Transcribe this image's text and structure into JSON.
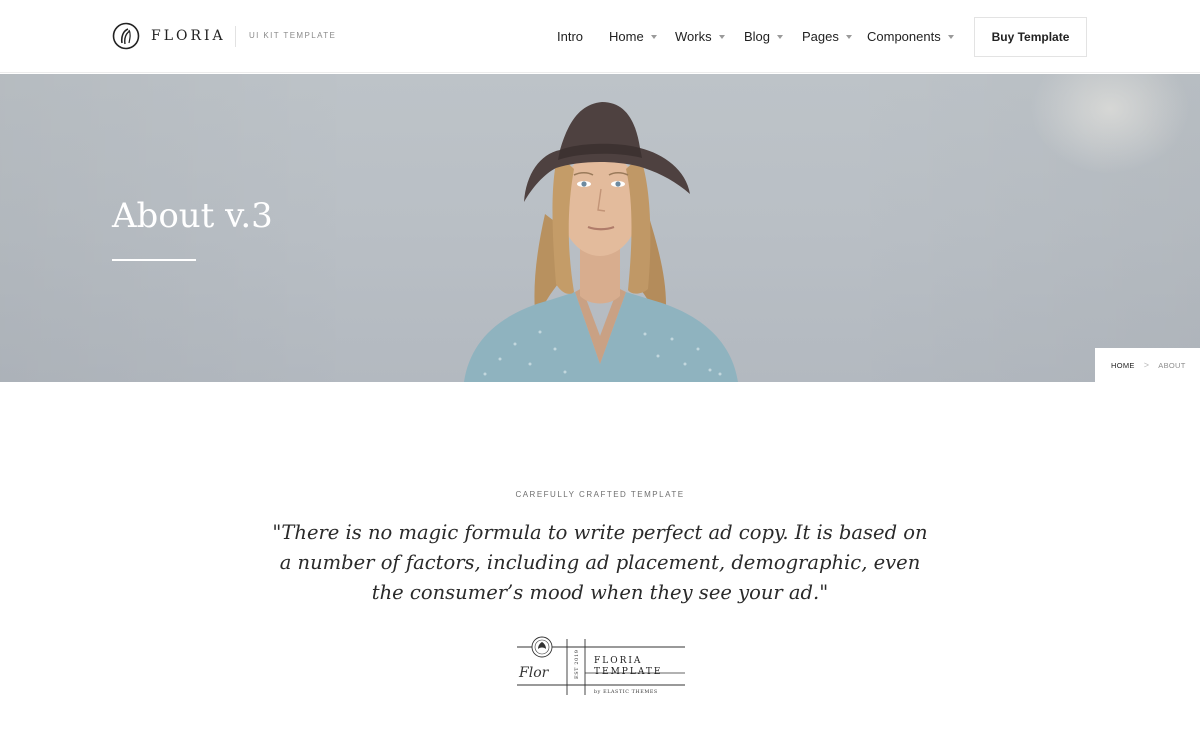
{
  "header": {
    "brand": "FLORIA",
    "tagline": "UI KIT TEMPLATE",
    "nav": [
      {
        "label": "Intro",
        "dropdown": false
      },
      {
        "label": "Home",
        "dropdown": true
      },
      {
        "label": "Works",
        "dropdown": true
      },
      {
        "label": "Blog",
        "dropdown": true
      },
      {
        "label": "Pages",
        "dropdown": true
      },
      {
        "label": "Components",
        "dropdown": true
      }
    ],
    "cta_label": "Buy Template"
  },
  "hero": {
    "title": "About v.3",
    "breadcrumb": {
      "home": "HOME",
      "separator": ">",
      "current": "ABOUT"
    }
  },
  "content": {
    "eyebrow": "CAREFULLY CRAFTED TEMPLATE",
    "quote": "\"There is no magic formula to write perfect ad copy. It is based on a number of factors, including ad placement, demographic, even the consumer’s mood when they see your ad.\""
  },
  "signature": {
    "script": "Flor",
    "est": "EST 2019",
    "line1": "FLORIA",
    "line2": "TEMPLATE",
    "credit": "by ELASTIC THEMES"
  },
  "colors": {
    "accent": "#222222",
    "hero_bg": "#bbc1c6",
    "muted_text": "#8a8a8a"
  }
}
